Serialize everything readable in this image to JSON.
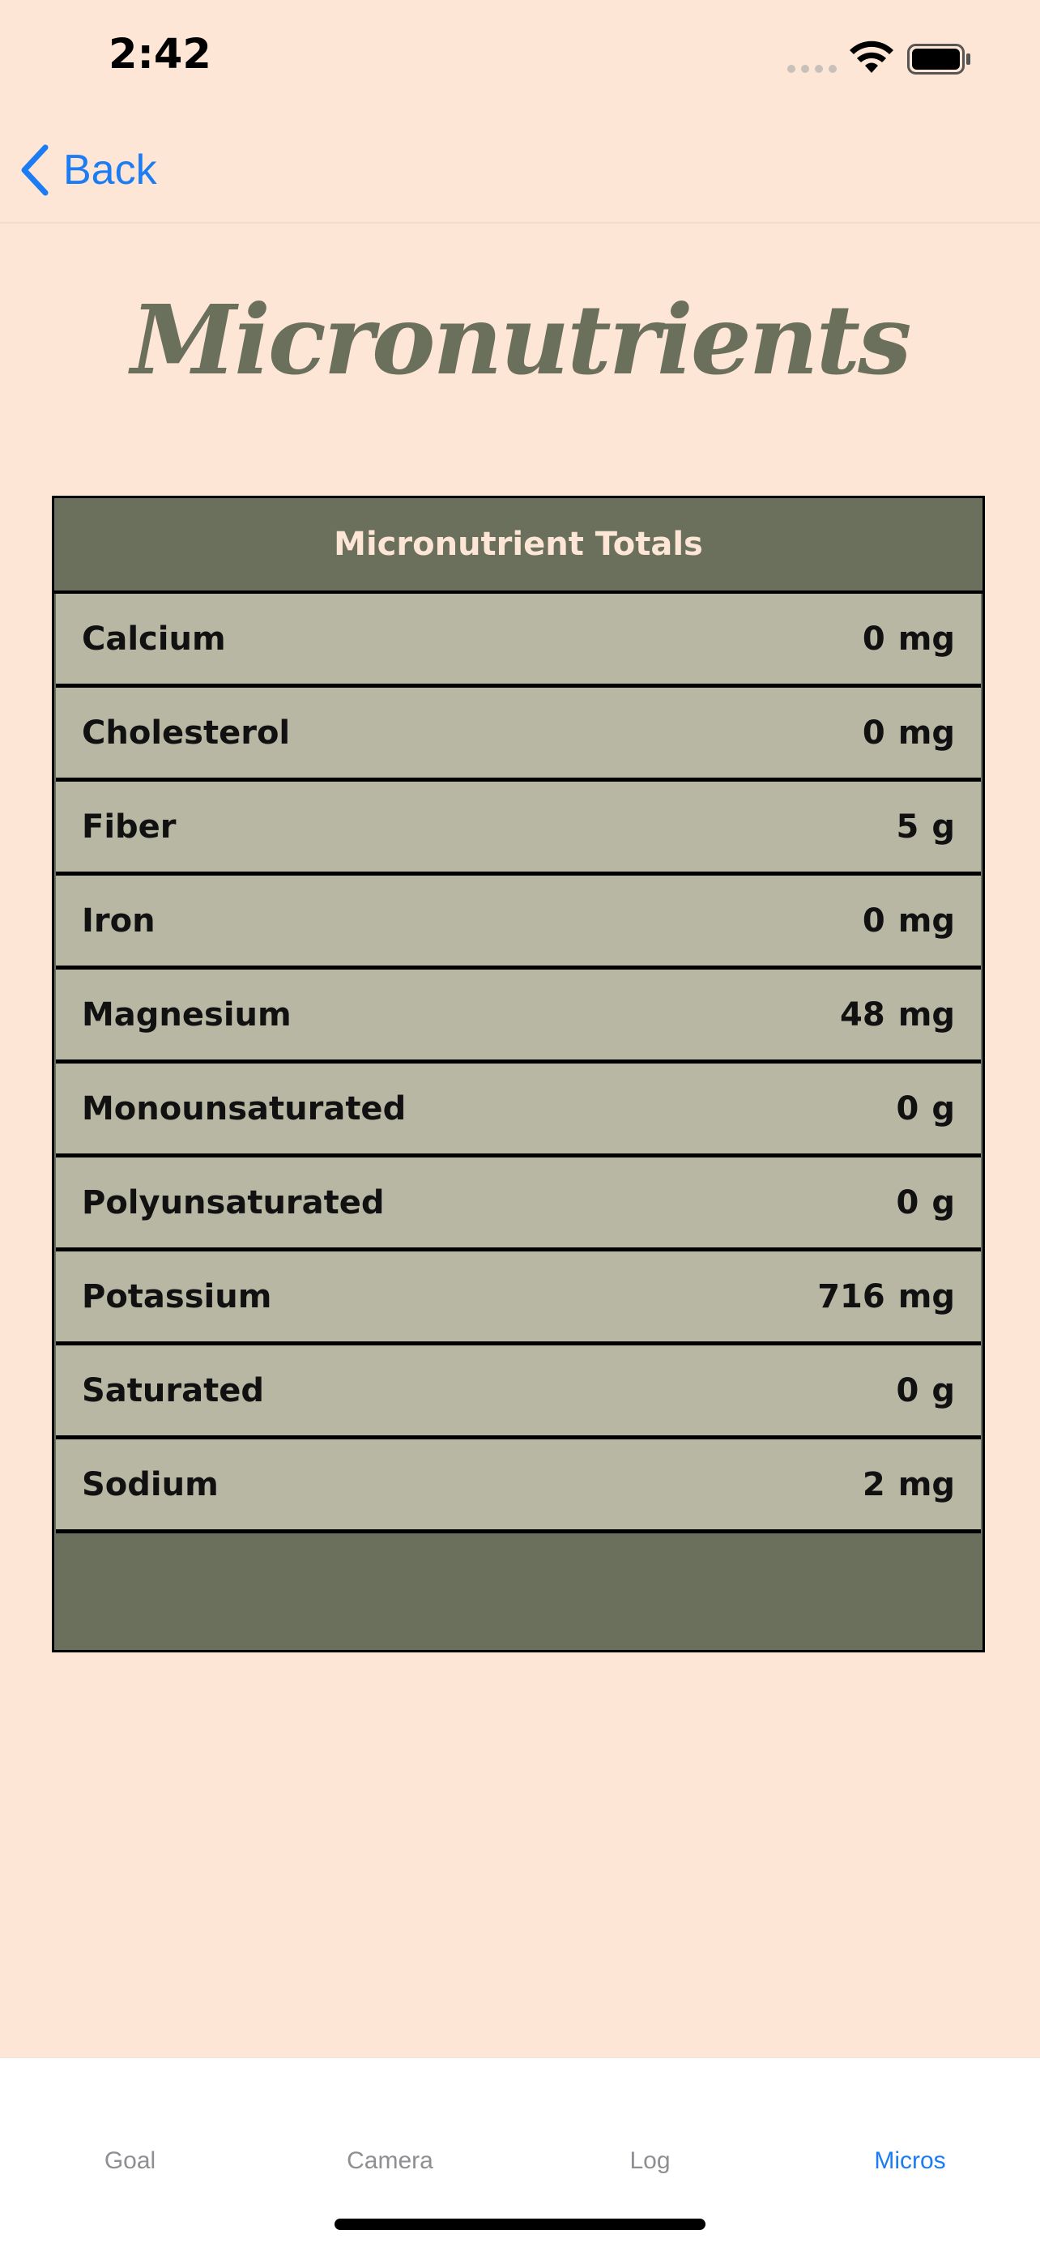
{
  "status": {
    "time": "2:42"
  },
  "nav": {
    "back_label": "Back"
  },
  "page": {
    "title": "Micronutrients"
  },
  "table": {
    "header": "Micronutrient Totals",
    "rows": [
      {
        "name": "Calcium",
        "amount": "0",
        "unit": "mg"
      },
      {
        "name": "Cholesterol",
        "amount": "0",
        "unit": "mg"
      },
      {
        "name": "Fiber",
        "amount": "5",
        "unit": "g"
      },
      {
        "name": "Iron",
        "amount": "0",
        "unit": "mg"
      },
      {
        "name": "Magnesium",
        "amount": "48",
        "unit": "mg"
      },
      {
        "name": "Monounsaturated",
        "amount": "0",
        "unit": "g"
      },
      {
        "name": "Polyunsaturated",
        "amount": "0",
        "unit": "g"
      },
      {
        "name": "Potassium",
        "amount": "716",
        "unit": "mg"
      },
      {
        "name": "Saturated",
        "amount": "0",
        "unit": "g"
      },
      {
        "name": "Sodium",
        "amount": "2",
        "unit": "mg"
      }
    ]
  },
  "tabs": [
    {
      "label": "Goal",
      "active": false
    },
    {
      "label": "Camera",
      "active": false
    },
    {
      "label": "Log",
      "active": false
    },
    {
      "label": "Micros",
      "active": true
    }
  ],
  "colors": {
    "background": "#FEE6D6",
    "accent": "#1C7CF3",
    "table_dark": "#6B705C",
    "row_fill": "#B7B7A4"
  },
  "icons": {
    "back": "chevron-left-icon",
    "wifi": "wifi-icon",
    "battery": "battery-icon",
    "signal": "cellular-signal-icon"
  }
}
